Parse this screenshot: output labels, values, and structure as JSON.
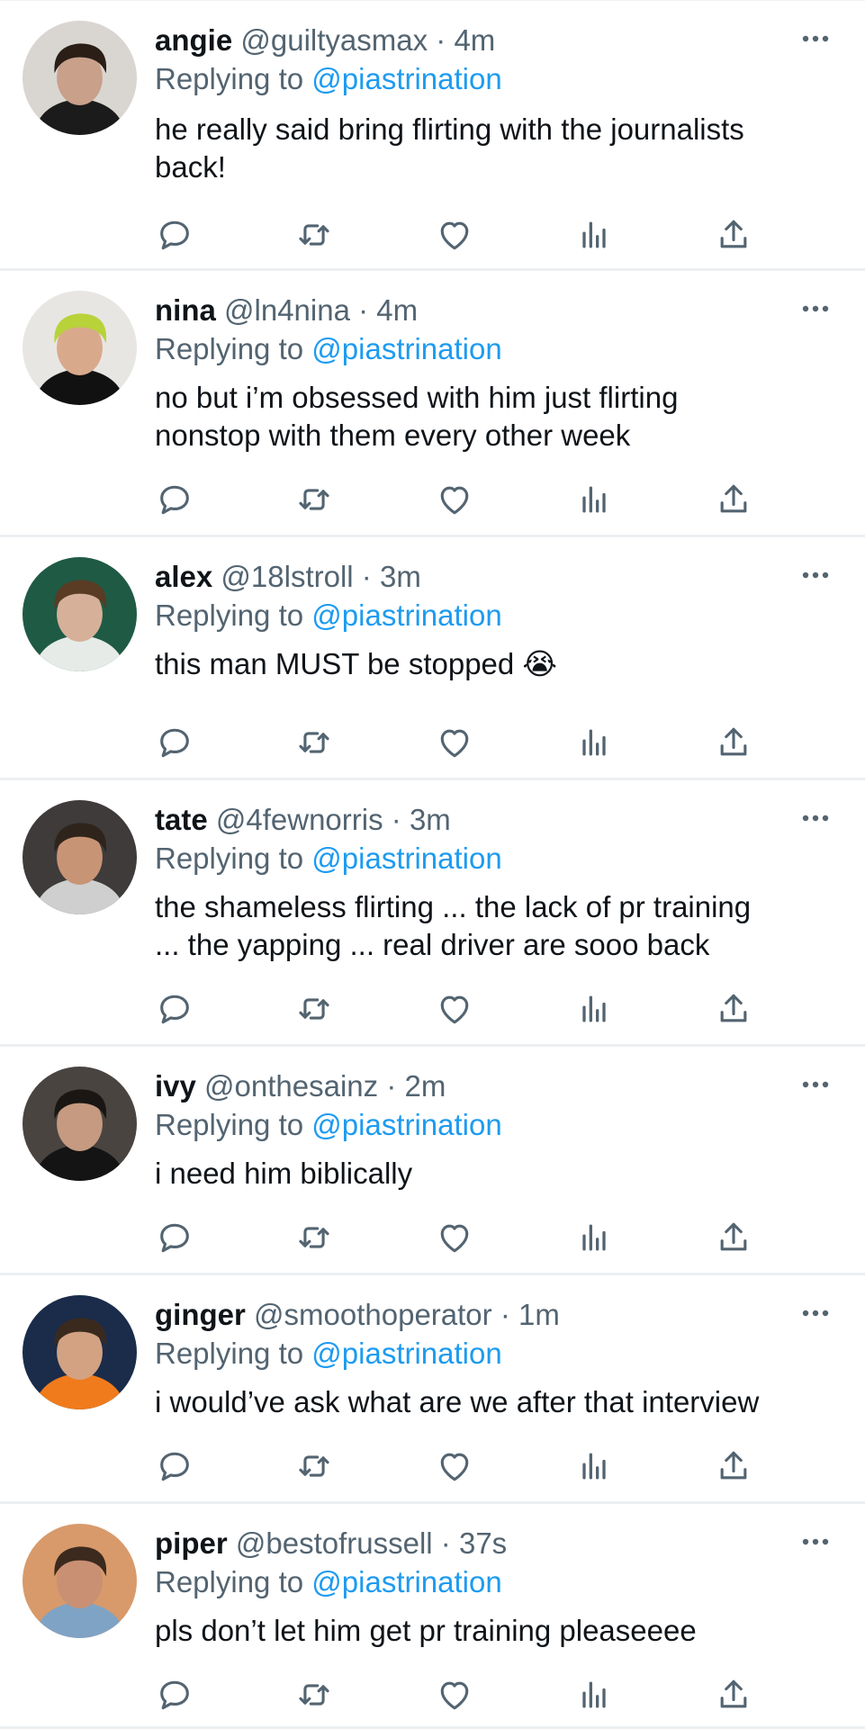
{
  "replies": [
    {
      "name": "angie",
      "handle": "@guiltyasmax",
      "time": "4m",
      "replying_label": "Replying to",
      "replying_to": "@piastrination",
      "text": "he really said bring flirting with the journalists\nback!",
      "avatar": {
        "bg": "#d9d6d2",
        "hair": "#2a1e17",
        "skin": "#c9a08a",
        "shirt": "#1b1b1b"
      }
    },
    {
      "name": "nina",
      "handle": "@ln4nina",
      "time": "4m",
      "replying_label": "Replying to",
      "replying_to": "@piastrination",
      "text": "no but i’m obsessed with him just flirting\nnonstop with them every other week",
      "avatar": {
        "bg": "#e8e6e3",
        "hair": "#b8d23a",
        "skin": "#d9a98c",
        "shirt": "#111111"
      }
    },
    {
      "name": "alex",
      "handle": "@18lstroll",
      "time": "3m",
      "replying_label": "Replying to",
      "replying_to": "@piastrination",
      "text": "this man MUST be stopped 😭",
      "avatar": {
        "bg": "#1f5a45",
        "hair": "#5a3b24",
        "skin": "#d6b098",
        "shirt": "#e6ebe8"
      }
    },
    {
      "name": "tate",
      "handle": "@4fewnorris",
      "time": "3m",
      "replying_label": "Replying to",
      "replying_to": "@piastrination",
      "text": "the shameless flirting ... the lack of pr training\n... the yapping ... real driver are sooo back",
      "avatar": {
        "bg": "#3e3b3a",
        "hair": "#2f241c",
        "skin": "#c89476",
        "shirt": "#cfcfcf"
      }
    },
    {
      "name": "ivy",
      "handle": "@onthesainz",
      "time": "2m",
      "replying_label": "Replying to",
      "replying_to": "@piastrination",
      "text": "i need him biblically",
      "avatar": {
        "bg": "#4a4440",
        "hair": "#1a1614",
        "skin": "#c59a80",
        "shirt": "#141414"
      }
    },
    {
      "name": "ginger",
      "handle": "@smoothoperator",
      "time": "1m",
      "replying_label": "Replying to",
      "replying_to": "@piastrination",
      "text": "i would’ve ask what are we after that interview",
      "avatar": {
        "bg": "#1a2c4a",
        "hair": "#3a2a1e",
        "skin": "#d3a283",
        "shirt": "#f07b1c"
      }
    },
    {
      "name": "piper",
      "handle": "@bestofrussell",
      "time": "37s",
      "replying_label": "Replying to",
      "replying_to": "@piastrination",
      "text": "pls don’t let him get pr training pleaseeee",
      "avatar": {
        "bg": "#d89a6a",
        "hair": "#3b2a1d",
        "skin": "#c99074",
        "shirt": "#7fa3c4"
      }
    }
  ],
  "separator": "·",
  "icons": {
    "more": "more-horizontal-icon",
    "reply": "reply-bubble-icon",
    "retweet": "retweet-icon",
    "like": "heart-icon",
    "views": "bar-chart-icon",
    "share": "share-upload-icon"
  },
  "colors": {
    "accent": "#1d9bf0",
    "muted": "#536471",
    "icon": "#536471",
    "divider": "#eceff1"
  }
}
